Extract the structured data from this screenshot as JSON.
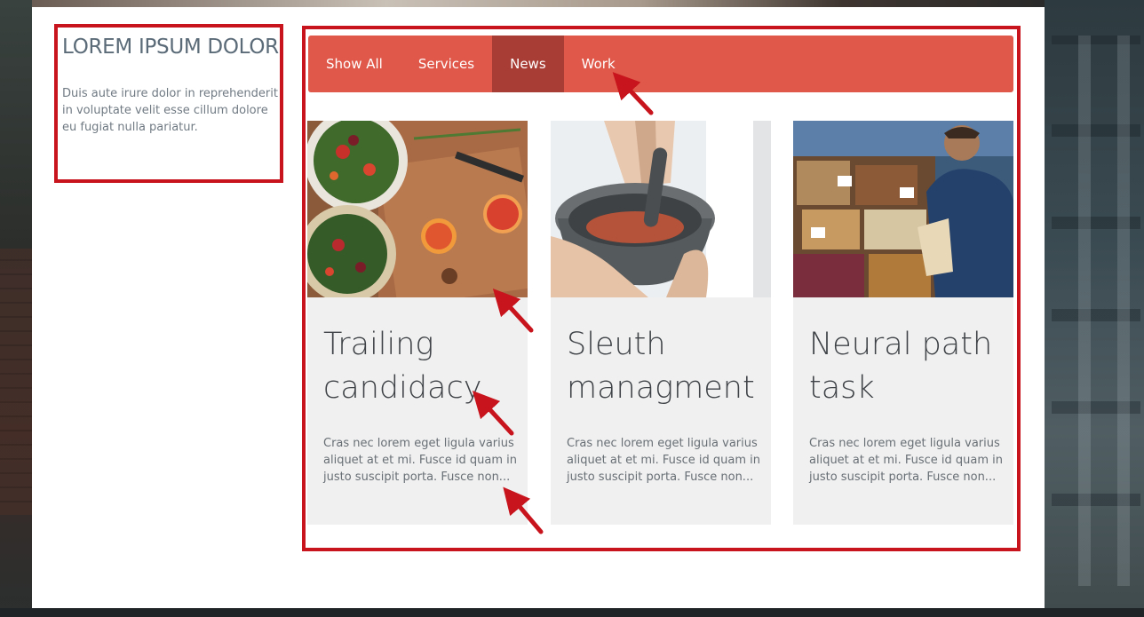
{
  "sidebar": {
    "title": "LOREM IPSUM DOLOR",
    "text": "Duis aute irure dolor in reprehenderit in voluptate velit esse cillum dolore eu fugiat nulla pariatur."
  },
  "tabs": [
    {
      "label": "Show All",
      "active": false
    },
    {
      "label": "Services",
      "active": false
    },
    {
      "label": "News",
      "active": true
    },
    {
      "label": "Work",
      "active": false
    }
  ],
  "cards": [
    {
      "title": "Trailing candidacy",
      "excerpt": "Cras nec lorem eget ligula varius aliquet at et mi. Fusce id quam in justo suscipit porta. Fusce non...",
      "image": "salad-cutting-board-photo"
    },
    {
      "title": "Sleuth managment",
      "excerpt": "Cras nec lorem eget ligula varius aliquet at et mi. Fusce id quam in justo suscipit porta. Fusce non...",
      "image": "mortar-and-pestle-photo"
    },
    {
      "title": "Neural path task",
      "excerpt": "Cras nec lorem eget ligula varius aliquet at et mi. Fusce id quam in justo suscipit porta. Fusce non...",
      "image": "market-vegetable-stall-photo"
    }
  ],
  "colors": {
    "tab_bar": "#df5849",
    "tab_active": "#a83d35",
    "annotation": "#c8141c",
    "card_bg": "#f0f0f0"
  }
}
